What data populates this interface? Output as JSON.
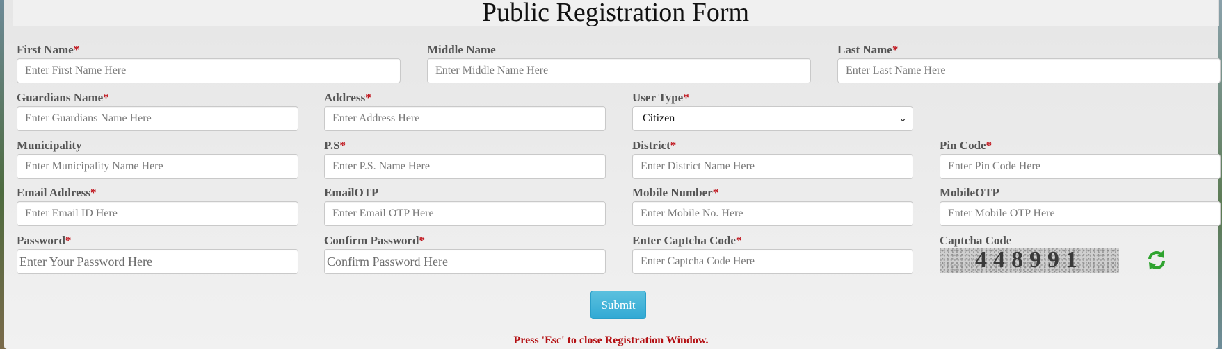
{
  "form": {
    "title": "Public Registration Form",
    "required_marker": "*",
    "fields": {
      "first_name": {
        "label": "First Name",
        "placeholder": "Enter First Name Here"
      },
      "middle_name": {
        "label": "Middle Name",
        "placeholder": "Enter Middle Name Here"
      },
      "last_name": {
        "label": "Last Name",
        "placeholder": "Enter Last Name Here"
      },
      "guardians_name": {
        "label": "Guardians Name",
        "placeholder": "Enter Guardians Name Here"
      },
      "address": {
        "label": "Address",
        "placeholder": "Enter Address Here"
      },
      "user_type": {
        "label": "User Type",
        "selected": "Citizen"
      },
      "municipality": {
        "label": "Municipality",
        "placeholder": "Enter Municipality Name Here"
      },
      "ps": {
        "label": "P.S",
        "placeholder": "Enter P.S. Name Here"
      },
      "district": {
        "label": "District",
        "placeholder": "Enter District Name Here"
      },
      "pin_code": {
        "label": "Pin Code",
        "placeholder": "Enter Pin Code Here"
      },
      "email": {
        "label": "Email Address",
        "placeholder": "Enter Email ID Here"
      },
      "email_otp": {
        "label": "EmailOTP",
        "placeholder": "Enter Email OTP Here"
      },
      "mobile": {
        "label": "Mobile Number",
        "placeholder": "Enter Mobile No. Here"
      },
      "mobile_otp": {
        "label": "MobileOTP",
        "placeholder": "Enter Mobile OTP Here"
      },
      "password": {
        "label": "Password",
        "placeholder": "Enter Your Password Here"
      },
      "confirm_password": {
        "label": "Confirm Password",
        "placeholder": "Confirm Password Here"
      },
      "captcha_input": {
        "label": "Enter Captcha Code",
        "placeholder": "Enter Captcha Code Here"
      },
      "captcha": {
        "label": "Captcha Code",
        "code": "448991"
      }
    },
    "submit_label": "Submit",
    "esc_note": "Press 'Esc' to close Registration Window.",
    "icons": {
      "refresh": "refresh-icon"
    },
    "colors": {
      "required": "#c0141c",
      "submit": "#31a9d4",
      "note": "#b30f12",
      "refresh": "#2fa32f"
    }
  }
}
